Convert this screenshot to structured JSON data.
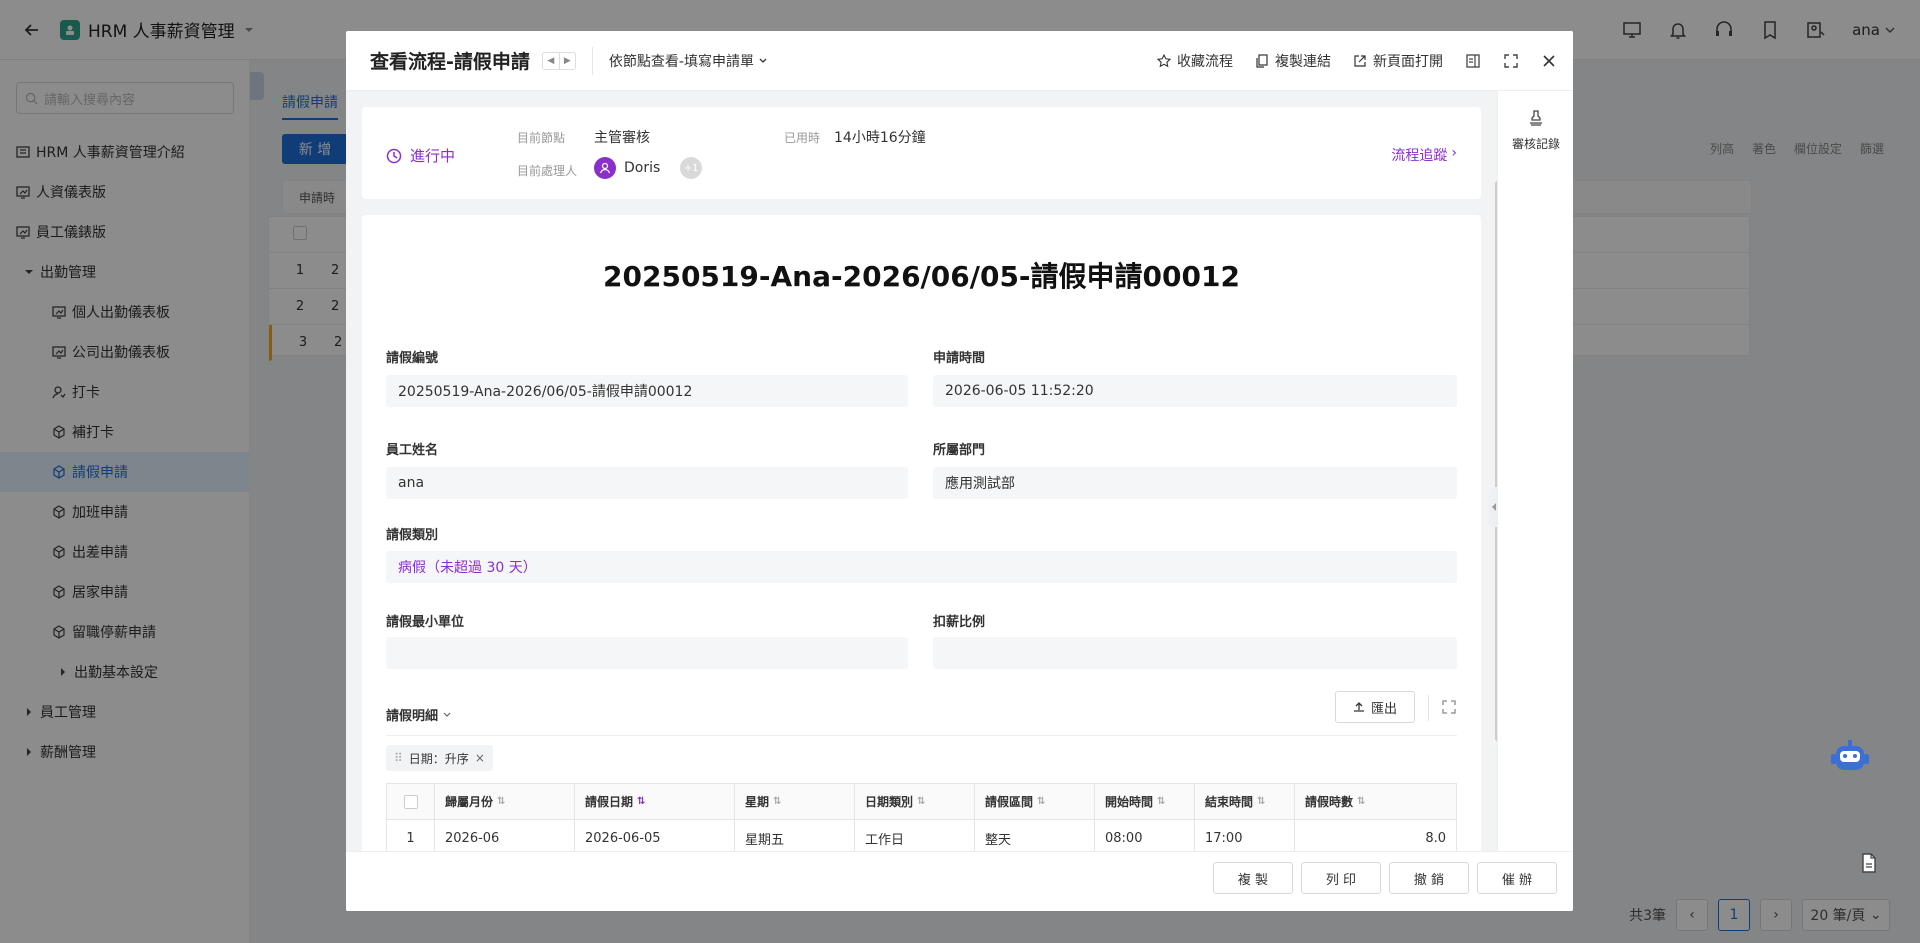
{
  "topbar": {
    "app_title": "HRM 人事薪資管理",
    "user": "ana",
    "icons": [
      "back-icon",
      "monitor-icon",
      "bell-icon",
      "headset-icon",
      "bookmark-icon",
      "user-settings-icon"
    ]
  },
  "sidebar": {
    "search_placeholder": "請輸入搜尋內容",
    "items": [
      {
        "label": "HRM 人事薪資管理介紹",
        "icon": "info-icon"
      },
      {
        "label": "人資儀表版",
        "icon": "dashboard-icon"
      },
      {
        "label": "員工儀錶版",
        "icon": "dashboard-icon"
      },
      {
        "label": "出勤管理",
        "icon": "caret-down-icon"
      },
      {
        "label": "個人出勤儀表板",
        "icon": "dashboard-icon"
      },
      {
        "label": "公司出勤儀表板",
        "icon": "dashboard-icon"
      },
      {
        "label": "打卡",
        "icon": "fingerprint-icon"
      },
      {
        "label": "補打卡",
        "icon": "cube-icon"
      },
      {
        "label": "請假申請",
        "icon": "cube-icon"
      },
      {
        "label": "加班申請",
        "icon": "cube-icon"
      },
      {
        "label": "出差申請",
        "icon": "cube-icon"
      },
      {
        "label": "居家申請",
        "icon": "cube-icon"
      },
      {
        "label": "留職停薪申請",
        "icon": "cube-icon"
      },
      {
        "label": "出勤基本設定",
        "icon": "caret-right-icon"
      },
      {
        "label": "員工管理",
        "icon": "caret-right-icon"
      },
      {
        "label": "薪酬管理",
        "icon": "caret-right-icon"
      }
    ]
  },
  "main": {
    "tab": "請假申請",
    "new_button": "新 增",
    "tools": [
      "列高",
      "著色",
      "欄位設定",
      "篩選"
    ],
    "filter_text": "申請時",
    "rows": [
      {
        "n": "1",
        "v": "2"
      },
      {
        "n": "2",
        "v": "2"
      },
      {
        "n": "3",
        "v": "2"
      }
    ],
    "pager": {
      "total": "共3筆",
      "page": "1",
      "size": "20 筆/頁"
    }
  },
  "modal": {
    "title": "查看流程-請假申請",
    "view_mode": "依節點查看-填寫申請單",
    "actions": [
      {
        "label": "收藏流程",
        "icon": "star-icon"
      },
      {
        "label": "複製連結",
        "icon": "copy-icon"
      },
      {
        "label": "新頁面打開",
        "icon": "external-link-icon"
      }
    ],
    "rail_label": "審核記錄",
    "status": {
      "label": "進行中",
      "node_label": "目前節點",
      "node_value": "主管審核",
      "elapsed_label": "已用時",
      "elapsed_value": "14小時16分鐘",
      "handler_label": "目前處理人",
      "handler_value": "Doris",
      "extra_count": "+1",
      "trace_link": "流程追蹤"
    },
    "doc_title": "20250519-Ana-2026/06/05-請假申請00012",
    "fields": {
      "leave_no_label": "請假編號",
      "leave_no": "20250519-Ana-2026/06/05-請假申請00012",
      "apply_time_label": "申請時間",
      "apply_time": "2026-06-05 11:52:20",
      "employee_label": "員工姓名",
      "employee": "ana",
      "dept_label": "所屬部門",
      "dept": "應用測試部",
      "type_label": "請假類別",
      "type": "病假（未超過 30 天）",
      "min_unit_label": "請假最小單位",
      "min_unit": "",
      "deduct_label": "扣薪比例",
      "deduct": ""
    },
    "detail": {
      "title": "請假明細",
      "export": "匯出",
      "sort_tag": "日期：升序",
      "columns": [
        "歸屬月份",
        "請假日期",
        "星期",
        "日期類別",
        "請假區間",
        "開始時間",
        "結束時間",
        "請假時數"
      ],
      "rows": [
        {
          "no": "1",
          "cells": [
            "2026-06",
            "2026-06-05",
            "星期五",
            "工作日",
            "整天",
            "08:00",
            "17:00",
            "8.0"
          ]
        }
      ]
    },
    "footer_buttons": [
      "複 製",
      "列 印",
      "撤 銷",
      "催 辦"
    ]
  }
}
